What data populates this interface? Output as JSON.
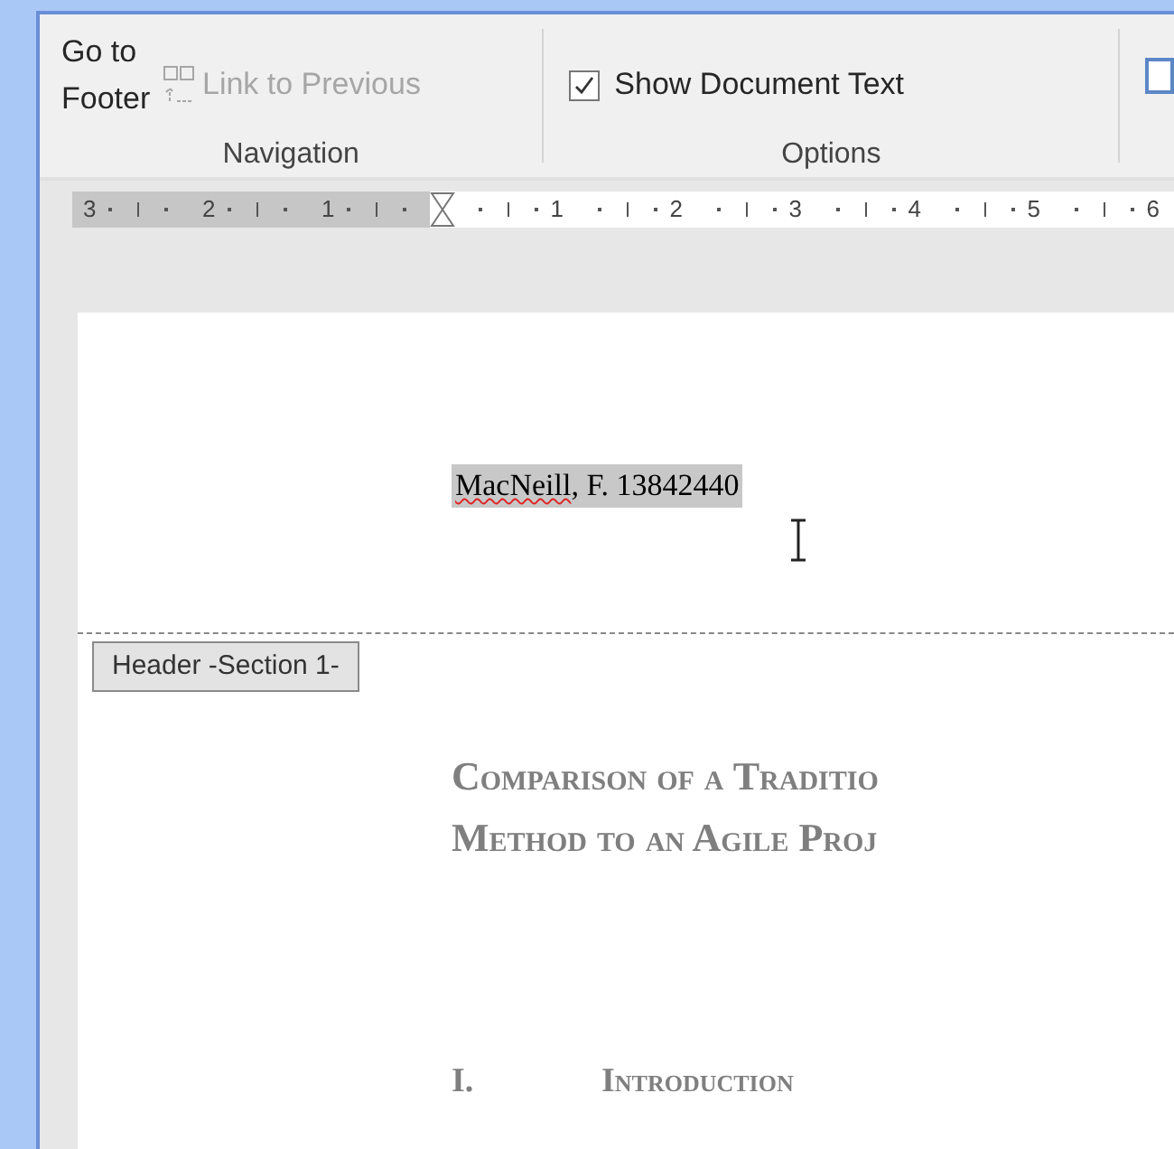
{
  "ribbon": {
    "navigation": {
      "go_to_footer": "Go to Footer",
      "link_to_previous": {
        "label": "Link to Previous",
        "disabled": true
      },
      "group_label": "Navigation"
    },
    "options": {
      "show_document_text": {
        "label": "Show Document Text",
        "checked": true
      },
      "group_label": "Options"
    }
  },
  "ruler": {
    "left_numbers": [
      "3",
      "2",
      "1"
    ],
    "right_numbers": [
      "1",
      "2",
      "3",
      "4",
      "5",
      "6"
    ]
  },
  "header": {
    "parts": [
      {
        "text": "MacNeill",
        "misspelled": true
      },
      {
        "text": ", F. 13842440",
        "misspelled": false
      }
    ],
    "selected": true,
    "tag": "Header -Section 1-"
  },
  "document": {
    "title_lines": [
      "Comparison of a Traditio",
      "Method to an Agile Proj"
    ],
    "heading": {
      "number": "I.",
      "text": "Introduction"
    }
  }
}
